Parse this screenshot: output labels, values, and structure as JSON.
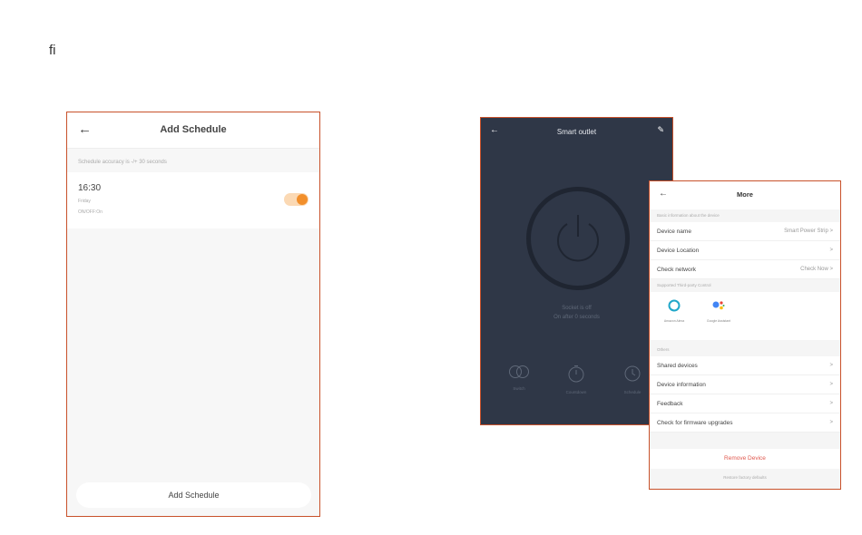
{
  "page_mark": "fi",
  "schedule": {
    "title": "Add Schedule",
    "back_icon": "arrow-left-icon",
    "note": "Schedule accuracy is -/+ 30 seconds",
    "item": {
      "time": "16:30",
      "day": "Friday",
      "sub": "ON/OFF:On",
      "enabled": true
    },
    "add_label": "Add Schedule",
    "accent": "#f28f2b"
  },
  "outlet": {
    "title": "Smart outlet",
    "back_icon": "arrow-left-icon",
    "edit_icon": "pencil-icon",
    "status_line1": "Socket is off",
    "status_line2": "On after 0 seconds",
    "buttons": [
      {
        "label": "Switch",
        "icon": "switch-icon"
      },
      {
        "label": "Countdown",
        "icon": "timer-icon"
      },
      {
        "label": "Schedule",
        "icon": "clock-icon"
      }
    ],
    "background": "#2f3747"
  },
  "more": {
    "title": "More",
    "back_icon": "arrow-left-icon",
    "section_basic": "Basic information about the device",
    "rows_basic": [
      {
        "label": "Device name",
        "value": "Smart Power Strip"
      },
      {
        "label": "Device Location",
        "value": ""
      },
      {
        "label": "Check network",
        "value": "Check Now"
      }
    ],
    "section_third": "Supported Third-party Control",
    "third_party": [
      {
        "label": "Amazon Alexa",
        "icon": "alexa-icon"
      },
      {
        "label": "Google Assistant",
        "icon": "google-assistant-icon"
      }
    ],
    "section_others": "Others",
    "rows_others": [
      {
        "label": "Shared devices"
      },
      {
        "label": "Device information"
      },
      {
        "label": "Feedback"
      },
      {
        "label": "Check for firmware upgrades"
      }
    ],
    "remove_label": "Remove Device",
    "restore_label": "Restore factory defaults",
    "remove_color": "#e0584e",
    "chevron": ">"
  }
}
